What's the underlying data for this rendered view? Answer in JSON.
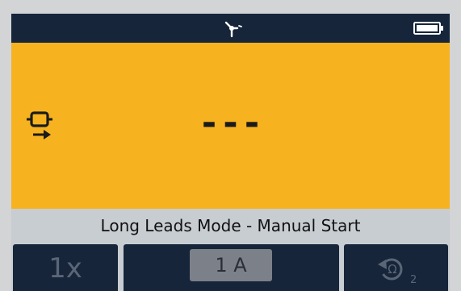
{
  "status_bar": {
    "signal_icon": "antenna-icon",
    "battery_icon": "battery-icon"
  },
  "display": {
    "leads_icon": "long-leads-icon",
    "reading": "---"
  },
  "mode_banner": {
    "text": "Long Leads Mode - Manual Start"
  },
  "softkeys": {
    "multiplier_label": "1x",
    "current_label": "1 A",
    "null_icon": "lead-null-icon",
    "null_subscript": "2"
  },
  "colors": {
    "display_background": "#f7b21f",
    "bar_dark": "#16253a",
    "banner_gray": "#c8cdd2"
  }
}
